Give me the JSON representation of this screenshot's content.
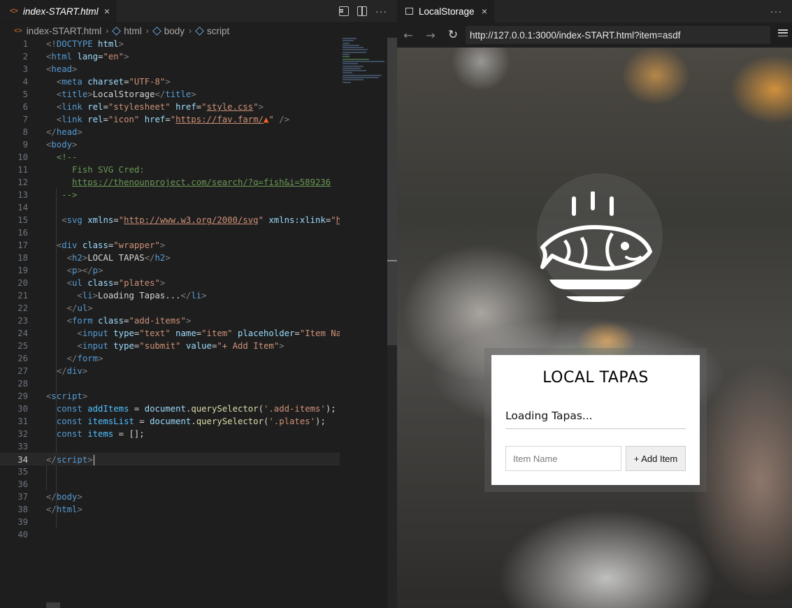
{
  "editor": {
    "tab_label": "index-START.html",
    "tab_icon": "<>",
    "breadcrumb": [
      "index-START.html",
      "html",
      "body",
      "script"
    ],
    "line_numbers": [
      "1",
      "2",
      "3",
      "4",
      "5",
      "6",
      "7",
      "8",
      "9",
      "10",
      "11",
      "12",
      "13",
      "14",
      "15",
      "16",
      "17",
      "18",
      "19",
      "20",
      "21",
      "22",
      "23",
      "24",
      "25",
      "26",
      "27",
      "28",
      "29",
      "30",
      "31",
      "32",
      "33",
      "34",
      "35",
      "36",
      "37",
      "38",
      "39",
      "40"
    ],
    "current_line": "34"
  },
  "browser": {
    "tab_label": "LocalStorage",
    "url": "http://127.0.0.1:3000/index-START.html?item=asdf",
    "page": {
      "heading": "LOCAL TAPAS",
      "plate_item": "Loading Tapas...",
      "input_placeholder": "Item Name",
      "submit_label": "+ Add Item"
    }
  },
  "icons": {
    "close": "×",
    "more": "···",
    "back": "←",
    "forward": "→",
    "reload": "↻"
  }
}
